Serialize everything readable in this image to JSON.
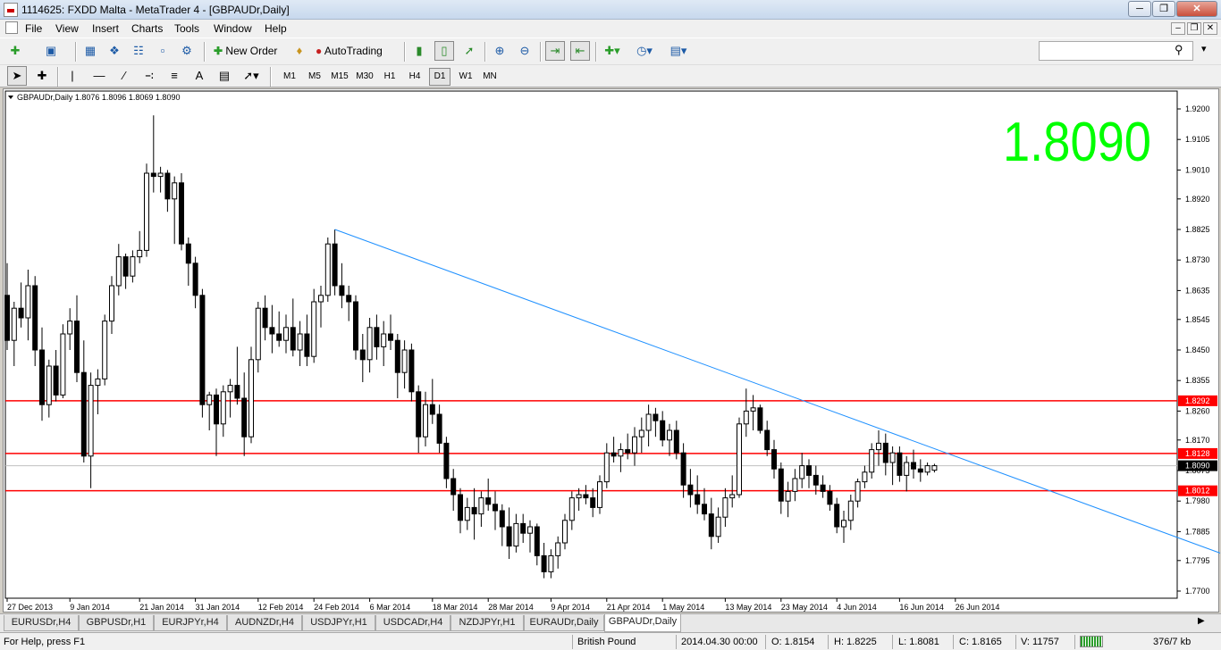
{
  "window": {
    "title": "1114625: FXDD Malta - MetaTrader 4 - [GBPAUDr,Daily]"
  },
  "menu": [
    "File",
    "View",
    "Insert",
    "Charts",
    "Tools",
    "Window",
    "Help"
  ],
  "toolbar": {
    "new_order": "New Order",
    "autotrading": "AutoTrading"
  },
  "timeframes": [
    {
      "label": "M1",
      "active": false
    },
    {
      "label": "M5",
      "active": false
    },
    {
      "label": "M15",
      "active": false
    },
    {
      "label": "M30",
      "active": false
    },
    {
      "label": "H1",
      "active": false
    },
    {
      "label": "H4",
      "active": false
    },
    {
      "label": "D1",
      "active": true
    },
    {
      "label": "W1",
      "active": false
    },
    {
      "label": "MN",
      "active": false
    }
  ],
  "chart_header": "GBPAUDr,Daily  1.8076 1.8096 1.8069 1.8090",
  "big_price": "1.8090",
  "colors": {
    "big_price": "#00ff00",
    "level_line": "#ff0000",
    "trend_line": "#1e90ff",
    "candle": "#000000"
  },
  "chart_data": {
    "type": "candlestick",
    "y_ticks": [
      "1.9200",
      "1.9105",
      "1.9010",
      "1.8920",
      "1.8825",
      "1.8730",
      "1.8635",
      "1.8545",
      "1.8450",
      "1.8355",
      "1.8260",
      "1.8170",
      "1.8075",
      "1.7980",
      "1.7885",
      "1.7795",
      "1.7700"
    ],
    "ylim": [
      1.77,
      1.92
    ],
    "x_ticks": [
      {
        "label": "27 Dec 2013",
        "i": 0
      },
      {
        "label": "9 Jan 2014",
        "i": 9
      },
      {
        "label": "21 Jan 2014",
        "i": 19
      },
      {
        "label": "31 Jan 2014",
        "i": 27
      },
      {
        "label": "12 Feb 2014",
        "i": 36
      },
      {
        "label": "24 Feb 2014",
        "i": 44
      },
      {
        "label": "6 Mar 2014",
        "i": 52
      },
      {
        "label": "18 Mar 2014",
        "i": 61
      },
      {
        "label": "28 Mar 2014",
        "i": 69
      },
      {
        "label": "9 Apr 2014",
        "i": 78
      },
      {
        "label": "21 Apr 2014",
        "i": 86
      },
      {
        "label": "1 May 2014",
        "i": 94
      },
      {
        "label": "13 May 2014",
        "i": 103
      },
      {
        "label": "23 May 2014",
        "i": 111
      },
      {
        "label": "4 Jun 2014",
        "i": 119
      },
      {
        "label": "16 Jun 2014",
        "i": 128
      },
      {
        "label": "26 Jun 2014",
        "i": 136
      }
    ],
    "levels": [
      {
        "price": 1.8292,
        "label": "1.8292"
      },
      {
        "price": 1.8128,
        "label": "1.8128"
      },
      {
        "price": 1.8012,
        "label": "1.8012"
      }
    ],
    "current_price": {
      "price": 1.809,
      "label": "1.8090"
    },
    "trendline": {
      "i1": 47,
      "p1": 1.8825,
      "i2": 174,
      "p2": 1.7818
    },
    "candles": [
      [
        1.862,
        1.872,
        1.845,
        1.848
      ],
      [
        1.848,
        1.86,
        1.84,
        1.858
      ],
      [
        1.858,
        1.866,
        1.852,
        1.855
      ],
      [
        1.855,
        1.87,
        1.848,
        1.865
      ],
      [
        1.865,
        1.868,
        1.84,
        1.845
      ],
      [
        1.845,
        1.852,
        1.823,
        1.828
      ],
      [
        1.828,
        1.842,
        1.824,
        1.84
      ],
      [
        1.84,
        1.845,
        1.829,
        1.831
      ],
      [
        1.831,
        1.853,
        1.83,
        1.85
      ],
      [
        1.85,
        1.858,
        1.845,
        1.854
      ],
      [
        1.854,
        1.862,
        1.835,
        1.838
      ],
      [
        1.838,
        1.848,
        1.81,
        1.812
      ],
      [
        1.812,
        1.838,
        1.802,
        1.834
      ],
      [
        1.834,
        1.839,
        1.825,
        1.836
      ],
      [
        1.836,
        1.856,
        1.834,
        1.854
      ],
      [
        1.854,
        1.868,
        1.85,
        1.865
      ],
      [
        1.865,
        1.878,
        1.862,
        1.874
      ],
      [
        1.874,
        1.875,
        1.864,
        1.868
      ],
      [
        1.868,
        1.876,
        1.866,
        1.874
      ],
      [
        1.874,
        1.882,
        1.872,
        1.876
      ],
      [
        1.876,
        1.903,
        1.874,
        1.9
      ],
      [
        1.9,
        1.918,
        1.894,
        1.899
      ],
      [
        1.899,
        1.902,
        1.894,
        1.9
      ],
      [
        1.9,
        1.901,
        1.888,
        1.892
      ],
      [
        1.892,
        1.899,
        1.878,
        1.897
      ],
      [
        1.897,
        1.9,
        1.876,
        1.878
      ],
      [
        1.878,
        1.88,
        1.865,
        1.872
      ],
      [
        1.872,
        1.874,
        1.858,
        1.862
      ],
      [
        1.862,
        1.864,
        1.824,
        1.828
      ],
      [
        1.828,
        1.832,
        1.82,
        1.831
      ],
      [
        1.831,
        1.833,
        1.812,
        1.822
      ],
      [
        1.822,
        1.834,
        1.818,
        1.832
      ],
      [
        1.832,
        1.836,
        1.824,
        1.834
      ],
      [
        1.834,
        1.846,
        1.828,
        1.83
      ],
      [
        1.83,
        1.838,
        1.812,
        1.818
      ],
      [
        1.818,
        1.846,
        1.816,
        1.842
      ],
      [
        1.842,
        1.86,
        1.838,
        1.858
      ],
      [
        1.858,
        1.862,
        1.848,
        1.852
      ],
      [
        1.852,
        1.859,
        1.844,
        1.85
      ],
      [
        1.85,
        1.857,
        1.846,
        1.848
      ],
      [
        1.848,
        1.856,
        1.844,
        1.852
      ],
      [
        1.852,
        1.861,
        1.843,
        1.845
      ],
      [
        1.845,
        1.854,
        1.84,
        1.85
      ],
      [
        1.85,
        1.856,
        1.84,
        1.843
      ],
      [
        1.843,
        1.864,
        1.841,
        1.86
      ],
      [
        1.86,
        1.865,
        1.852,
        1.862
      ],
      [
        1.862,
        1.88,
        1.86,
        1.878
      ],
      [
        1.878,
        1.8825,
        1.862,
        1.865
      ],
      [
        1.865,
        1.872,
        1.858,
        1.862
      ],
      [
        1.862,
        1.865,
        1.854,
        1.86
      ],
      [
        1.86,
        1.862,
        1.842,
        1.845
      ],
      [
        1.845,
        1.85,
        1.835,
        1.842
      ],
      [
        1.842,
        1.855,
        1.838,
        1.852
      ],
      [
        1.852,
        1.856,
        1.842,
        1.846
      ],
      [
        1.846,
        1.854,
        1.84,
        1.85
      ],
      [
        1.85,
        1.856,
        1.845,
        1.848
      ],
      [
        1.848,
        1.85,
        1.83,
        1.838
      ],
      [
        1.838,
        1.848,
        1.833,
        1.845
      ],
      [
        1.845,
        1.847,
        1.829,
        1.832
      ],
      [
        1.832,
        1.834,
        1.813,
        1.818
      ],
      [
        1.818,
        1.832,
        1.815,
        1.828
      ],
      [
        1.828,
        1.836,
        1.822,
        1.825
      ],
      [
        1.825,
        1.828,
        1.813,
        1.816
      ],
      [
        1.816,
        1.818,
        1.802,
        1.805
      ],
      [
        1.805,
        1.808,
        1.795,
        1.8
      ],
      [
        1.8,
        1.802,
        1.788,
        1.792
      ],
      [
        1.792,
        1.799,
        1.789,
        1.796
      ],
      [
        1.796,
        1.802,
        1.786,
        1.794
      ],
      [
        1.794,
        1.801,
        1.79,
        1.799
      ],
      [
        1.799,
        1.805,
        1.795,
        1.797
      ],
      [
        1.797,
        1.801,
        1.789,
        1.795
      ],
      [
        1.795,
        1.797,
        1.784,
        1.79
      ],
      [
        1.79,
        1.796,
        1.78,
        1.784
      ],
      [
        1.784,
        1.794,
        1.782,
        1.791
      ],
      [
        1.791,
        1.794,
        1.785,
        1.788
      ],
      [
        1.788,
        1.792,
        1.782,
        1.79
      ],
      [
        1.79,
        1.791,
        1.778,
        1.781
      ],
      [
        1.781,
        1.785,
        1.774,
        1.776
      ],
      [
        1.776,
        1.783,
        1.774,
        1.781
      ],
      [
        1.781,
        1.787,
        1.777,
        1.785
      ],
      [
        1.785,
        1.794,
        1.783,
        1.792
      ],
      [
        1.792,
        1.801,
        1.789,
        1.799
      ],
      [
        1.799,
        1.802,
        1.795,
        1.8
      ],
      [
        1.8,
        1.803,
        1.797,
        1.799
      ],
      [
        1.799,
        1.802,
        1.793,
        1.796
      ],
      [
        1.796,
        1.806,
        1.794,
        1.804
      ],
      [
        1.804,
        1.816,
        1.802,
        1.813
      ],
      [
        1.813,
        1.818,
        1.81,
        1.812
      ],
      [
        1.812,
        1.816,
        1.807,
        1.814
      ],
      [
        1.814,
        1.819,
        1.811,
        1.813
      ],
      [
        1.813,
        1.821,
        1.809,
        1.818
      ],
      [
        1.818,
        1.824,
        1.813,
        1.82
      ],
      [
        1.82,
        1.828,
        1.815,
        1.825
      ],
      [
        1.825,
        1.827,
        1.818,
        1.823
      ],
      [
        1.823,
        1.826,
        1.815,
        1.817
      ],
      [
        1.817,
        1.822,
        1.812,
        1.82
      ],
      [
        1.82,
        1.823,
        1.811,
        1.813
      ],
      [
        1.813,
        1.816,
        1.799,
        1.803
      ],
      [
        1.803,
        1.808,
        1.796,
        1.8
      ],
      [
        1.8,
        1.806,
        1.794,
        1.797
      ],
      [
        1.797,
        1.802,
        1.792,
        1.794
      ],
      [
        1.794,
        1.799,
        1.783,
        1.787
      ],
      [
        1.787,
        1.796,
        1.785,
        1.793
      ],
      [
        1.793,
        1.802,
        1.79,
        1.799
      ],
      [
        1.799,
        1.806,
        1.796,
        1.8
      ],
      [
        1.8,
        1.824,
        1.799,
        1.822
      ],
      [
        1.822,
        1.833,
        1.818,
        1.826
      ],
      [
        1.826,
        1.831,
        1.82,
        1.827
      ],
      [
        1.827,
        1.828,
        1.819,
        1.82
      ],
      [
        1.82,
        1.823,
        1.812,
        1.814
      ],
      [
        1.814,
        1.817,
        1.805,
        1.808
      ],
      [
        1.808,
        1.81,
        1.794,
        1.798
      ],
      [
        1.798,
        1.804,
        1.793,
        1.801
      ],
      [
        1.801,
        1.808,
        1.798,
        1.805
      ],
      [
        1.805,
        1.813,
        1.802,
        1.809
      ],
      [
        1.809,
        1.811,
        1.802,
        1.806
      ],
      [
        1.806,
        1.809,
        1.8,
        1.803
      ],
      [
        1.803,
        1.806,
        1.799,
        1.801
      ],
      [
        1.801,
        1.803,
        1.795,
        1.797
      ],
      [
        1.797,
        1.799,
        1.788,
        1.79
      ],
      [
        1.79,
        1.795,
        1.785,
        1.792
      ],
      [
        1.792,
        1.8,
        1.789,
        1.798
      ],
      [
        1.798,
        1.805,
        1.796,
        1.804
      ],
      [
        1.804,
        1.809,
        1.802,
        1.807
      ],
      [
        1.807,
        1.816,
        1.805,
        1.814
      ],
      [
        1.814,
        1.82,
        1.809,
        1.816
      ],
      [
        1.816,
        1.819,
        1.806,
        1.81
      ],
      [
        1.81,
        1.815,
        1.803,
        1.813
      ],
      [
        1.813,
        1.815,
        1.804,
        1.806
      ],
      [
        1.806,
        1.812,
        1.801,
        1.81
      ],
      [
        1.81,
        1.814,
        1.805,
        1.808
      ],
      [
        1.808,
        1.811,
        1.804,
        1.807
      ],
      [
        1.807,
        1.81,
        1.806,
        1.809
      ],
      [
        1.8076,
        1.8096,
        1.8069,
        1.809
      ]
    ]
  },
  "symbol_tabs": [
    {
      "label": "EURUSDr,H4",
      "active": false
    },
    {
      "label": "GBPUSDr,H1",
      "active": false
    },
    {
      "label": "EURJPYr,H4",
      "active": false
    },
    {
      "label": "AUDNZDr,H4",
      "active": false
    },
    {
      "label": "USDJPYr,H1",
      "active": false
    },
    {
      "label": "USDCADr,H4",
      "active": false
    },
    {
      "label": "NZDJPYr,H1",
      "active": false
    },
    {
      "label": "EURAUDr,Daily",
      "active": false
    },
    {
      "label": "GBPAUDr,Daily",
      "active": true
    }
  ],
  "status": {
    "help": "For Help, press F1",
    "profile": "British Pound",
    "datetime": "2014.04.30 00:00",
    "open": "O: 1.8154",
    "high": "H: 1.8225",
    "low": "L: 1.8081",
    "close": "C: 1.8165",
    "volume": "V: 11757",
    "traffic": "376/7 kb"
  }
}
